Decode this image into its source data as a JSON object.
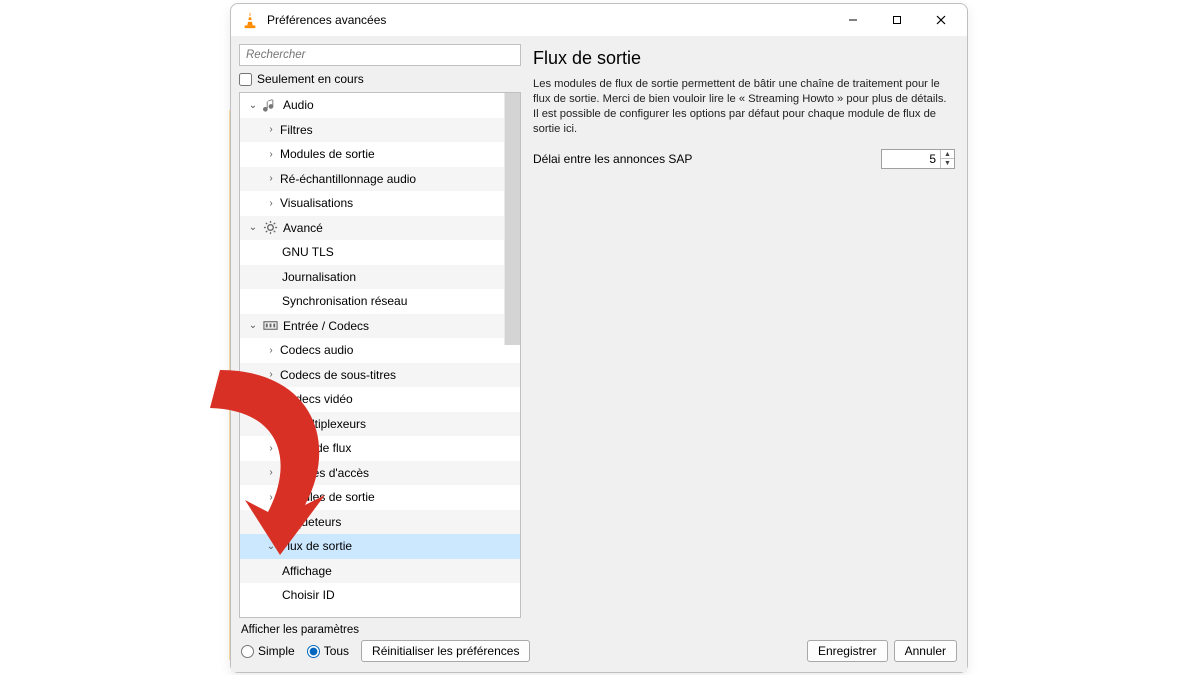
{
  "window": {
    "title": "Préférences avancées"
  },
  "sidebar": {
    "search_placeholder": "Rechercher",
    "only_running_label": "Seulement en cours",
    "tree": {
      "audio": "Audio",
      "audio_filters": "Filtres",
      "audio_output_modules": "Modules de sortie",
      "audio_resampling": "Ré-échantillonnage audio",
      "audio_visual": "Visualisations",
      "advanced": "Avancé",
      "adv_gnutls": "GNU TLS",
      "adv_logging": "Journalisation",
      "adv_netsync": "Synchronisation réseau",
      "input_codecs": "Entrée / Codecs",
      "ic_audio_codecs": "Codecs audio",
      "ic_sub_codecs": "Codecs de sous-titres",
      "ic_video_codecs": "Codecs vidéo",
      "ic_demux": "Démultiplexeurs",
      "ic_stream_filters": "Filtres de flux",
      "ic_access_modules": "Modules d'accès",
      "ic_access_output": "Modules de sortie",
      "ic_packetizers": "Paqueteurs",
      "ic_sout": "Flux de sortie",
      "ic_sout_display": "Affichage",
      "ic_sout_setid": "Choisir ID"
    }
  },
  "right": {
    "title": "Flux de sortie",
    "description": "Les modules de flux de sortie permettent de bâtir une chaîne de traitement pour le flux de sortie. Merci de bien vouloir lire le « Streaming Howto » pour plus de détails. Il est possible de configurer les options par défaut pour chaque module de flux de sortie ici.",
    "sap_label": "Délai entre les annonces SAP",
    "sap_value": "5"
  },
  "footer": {
    "show_settings_label": "Afficher les paramètres",
    "radio_simple": "Simple",
    "radio_all": "Tous",
    "reset_btn": "Réinitialiser les préférences",
    "save_btn": "Enregistrer",
    "cancel_btn": "Annuler"
  }
}
